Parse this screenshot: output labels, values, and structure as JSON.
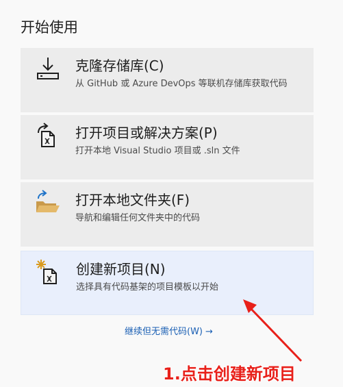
{
  "page": {
    "title": "开始使用"
  },
  "cards": [
    {
      "title": "克隆存储库(C)",
      "desc": "从 GitHub 或 Azure DevOps 等联机存储库获取代码",
      "icon": "download-icon"
    },
    {
      "title": "打开项目或解决方案(P)",
      "desc": "打开本地 Visual Studio 项目或 .sln 文件",
      "icon": "open-project-icon"
    },
    {
      "title": "打开本地文件夹(F)",
      "desc": "导航和编辑任何文件夹中的代码",
      "icon": "folder-open-icon"
    },
    {
      "title": "创建新项目(N)",
      "desc": "选择具有代码基架的项目模板以开始",
      "icon": "new-project-icon"
    }
  ],
  "continue_link": {
    "label": "继续但无需代码(W)",
    "arrow": "→"
  },
  "annotation": {
    "text": "1.点击创建新项目"
  },
  "colors": {
    "selected_card": "#e9effc",
    "card": "#ececec",
    "link": "#1a5fb4",
    "annotation": "#e8201a"
  }
}
